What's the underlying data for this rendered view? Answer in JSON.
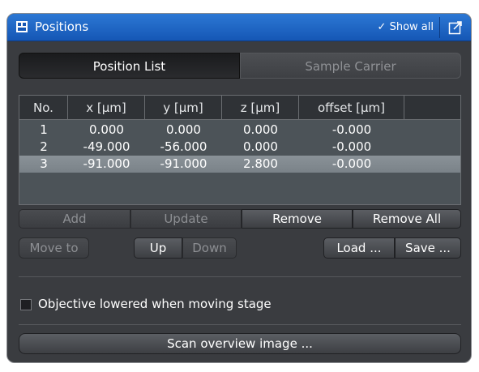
{
  "window": {
    "title": "Positions",
    "show_all": "Show all"
  },
  "tabs": [
    {
      "label": "Position List"
    },
    {
      "label": "Sample Carrier"
    }
  ],
  "table": {
    "headers": [
      "No.",
      "x [µm]",
      "y [µm]",
      "z [µm]",
      "offset [µm]"
    ],
    "rows": [
      [
        "1",
        "0.000",
        "0.000",
        "0.000",
        "-0.000"
      ],
      [
        "2",
        "-49.000",
        "-56.000",
        "0.000",
        "-0.000"
      ],
      [
        "3",
        "-91.000",
        "-91.000",
        "2.800",
        "-0.000"
      ]
    ]
  },
  "buttons": {
    "add": "Add",
    "update": "Update",
    "remove": "Remove",
    "remove_all": "Remove All",
    "move_to": "Move to",
    "up": "Up",
    "down": "Down",
    "load": "Load ...",
    "save": "Save ...",
    "scan": "Scan overview image ..."
  },
  "checkbox": {
    "label": "Objective lowered when moving stage",
    "checked": false
  },
  "colors": {
    "titlebar": "#1f68c6",
    "panel": "#3a3c40",
    "selected_row": "#848c92"
  }
}
